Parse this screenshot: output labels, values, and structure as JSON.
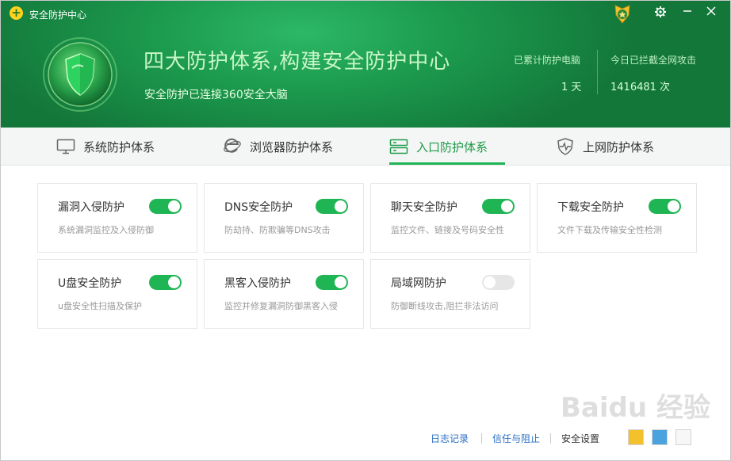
{
  "window": {
    "title": "安全防护中心"
  },
  "hero": {
    "headline": "四大防护体系,构建安全防护中心",
    "subline": "安全防护已连接360安全大脑",
    "stats": [
      {
        "label": "已累计防护电脑",
        "value": "1 天"
      },
      {
        "label": "今日已拦截全网攻击",
        "value": "1416481 次"
      }
    ]
  },
  "tabs": [
    {
      "label": "系统防护体系",
      "icon": "monitor-icon"
    },
    {
      "label": "浏览器防护体系",
      "icon": "browser-e-icon"
    },
    {
      "label": "入口防护体系",
      "icon": "server-icon",
      "active": true
    },
    {
      "label": "上网防护体系",
      "icon": "shield-pulse-icon"
    }
  ],
  "cards": [
    {
      "title": "漏洞入侵防护",
      "desc": "系统漏洞监控及入侵防御",
      "enabled": true
    },
    {
      "title": "DNS安全防护",
      "desc": "防劫持、防欺骗等DNS攻击",
      "enabled": true
    },
    {
      "title": "聊天安全防护",
      "desc": "监控文件、链接及号码安全性",
      "enabled": true
    },
    {
      "title": "下载安全防护",
      "desc": "文件下载及传输安全性检测",
      "enabled": true
    },
    {
      "title": "U盘安全防护",
      "desc": "u盘安全性扫描及保护",
      "enabled": true
    },
    {
      "title": "黑客入侵防护",
      "desc": "监控并修复漏洞防御黑客入侵",
      "enabled": true
    },
    {
      "title": "局域网防护",
      "desc": "防御断线攻击,阻拦非法访问",
      "enabled": false
    }
  ],
  "footer": {
    "log": "日志记录",
    "trust": "信任与阻止",
    "settings": "安全设置"
  },
  "watermark": "Baidu 经验",
  "colors": {
    "accent": "#1fb554",
    "header": "#17873f",
    "link": "#2a6fc4"
  }
}
